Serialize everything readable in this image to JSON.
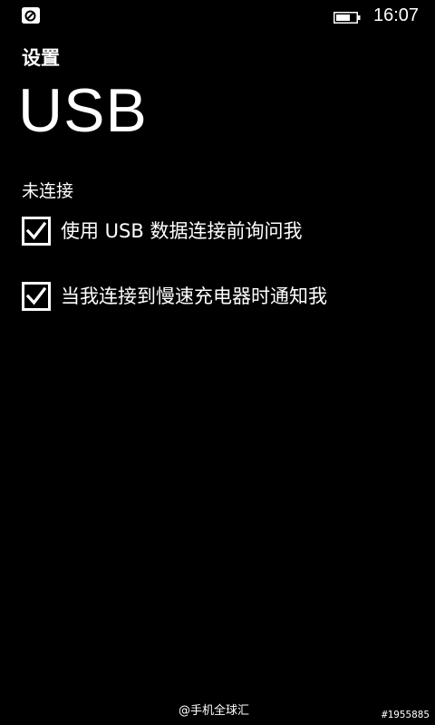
{
  "status_bar": {
    "left_icon": "data-sense-icon",
    "battery_icon": "battery-icon",
    "battery_level": 0.7,
    "time": "16:07"
  },
  "header": {
    "section": "设置",
    "title": "USB"
  },
  "main": {
    "connection_status": "未连接",
    "options": [
      {
        "label": "使用 USB 数据连接前询问我",
        "checked": true
      },
      {
        "label": "当我连接到慢速充电器时通知我",
        "checked": true
      }
    ]
  },
  "watermark": {
    "source": "@手机全球汇",
    "id": "#1955885"
  },
  "colors": {
    "background": "#000000",
    "foreground": "#ffffff"
  }
}
